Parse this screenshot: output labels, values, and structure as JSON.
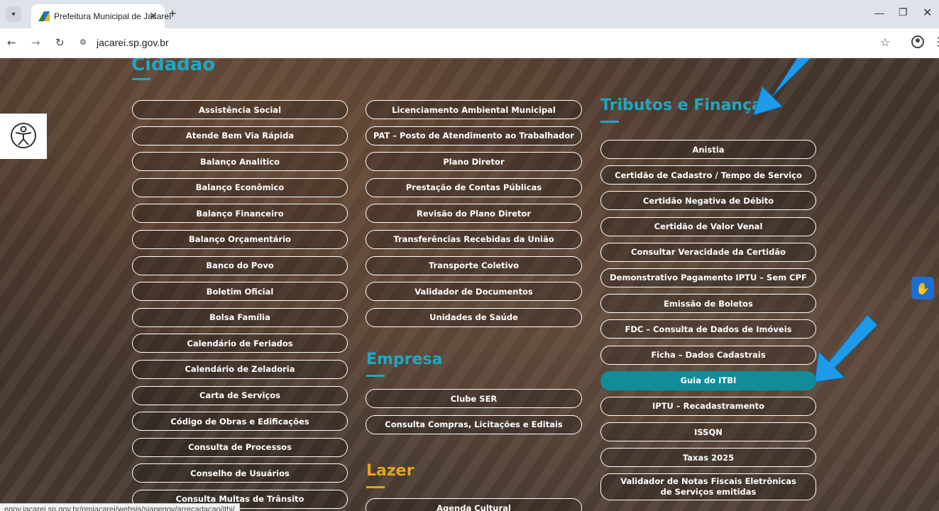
{
  "browser": {
    "tab_title": "Prefeitura Municipal de Jacareí",
    "url": "jacarei.sp.gov.br",
    "status_url": "egov.jacarei.sp.gov.br/pmjacarei/websis/siapegov/arrecadacao/itbi/"
  },
  "sections": {
    "cidadao": {
      "title": "Cidadão",
      "items": [
        "Assistência Social",
        "Atende Bem Via Rápida",
        "Balanço Analítico",
        "Balanço Econômico",
        "Balanço Financeiro",
        "Balanço Orçamentário",
        "Banco do Povo",
        "Boletim Oficial",
        "Bolsa Família",
        "Calendário de Feriados",
        "Calendário de Zeladoria",
        "Carta de Serviços",
        "Código de Obras e Edificações",
        "Consulta de Processos",
        "Conselho de Usuários",
        "Consulta Multas de Trânsito"
      ]
    },
    "cidadao2": {
      "items": [
        "Licenciamento Ambiental Municipal",
        "PAT – Posto de Atendimento ao Trabalhador",
        "Plano Diretor",
        "Prestação de Contas Públicas",
        "Revisão do Plano Diretor",
        "Transferências Recebidas da União",
        "Transporte Coletivo",
        "Validador de Documentos",
        "Unidades de Saúde"
      ]
    },
    "empresa": {
      "title": "Empresa",
      "items": [
        "Clube SER",
        "Consulta Compras, Licitações e Editais"
      ]
    },
    "lazer": {
      "title": "Lazer",
      "items": [
        "Agenda Cultural"
      ]
    },
    "tributos": {
      "title": "Tributos e Finanças",
      "items": [
        "Anistia",
        "Certidão de Cadastro / Tempo de Serviço",
        "Certidão Negativa de Débito",
        "Certidão de Valor Venal",
        "Consultar Veracidade da Certidão",
        "Demonstrativo Pagamento IPTU – Sem CPF",
        "Emissão de Boletos",
        "FDC – Consulta de Dados de Imóveis",
        "Ficha – Dados Cadastrais",
        "Guia do ITBI",
        "IPTU – Recadastramento",
        "ISSQN",
        "Taxas 2025",
        "Validador de Notas Fiscais Eletrônicas de Serviços emitidas"
      ],
      "active_item": "Guia do ITBI"
    }
  },
  "icons": {
    "accessibility": "accessibility-icon",
    "sign_language": "vlibras-hand-icon",
    "annotation": "blue-pointer-arrow"
  },
  "colors": {
    "accent": "#1fa7c2",
    "active_button": "#138c99",
    "lazer_heading": "#e0a41c",
    "annotation_arrow": "#1e9be8"
  }
}
